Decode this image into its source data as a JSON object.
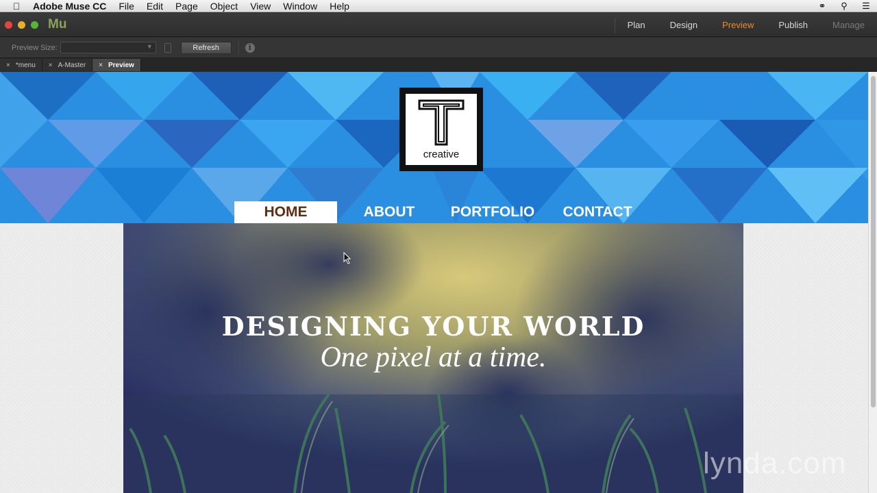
{
  "menubar": {
    "app_name": "Adobe Muse CC",
    "menus": [
      "File",
      "Edit",
      "Page",
      "Object",
      "View",
      "Window",
      "Help"
    ]
  },
  "titlebar": {
    "logo": "Mu",
    "modes": [
      "Plan",
      "Design",
      "Preview",
      "Publish",
      "Manage"
    ],
    "active_mode": "Preview",
    "accent": "#f08a2e"
  },
  "toolbar": {
    "preview_size_label": "Preview Size:",
    "preview_size_value": "",
    "refresh_label": "Refresh"
  },
  "tabs": [
    {
      "label": "*menu",
      "active": false
    },
    {
      "label": "A-Master",
      "active": false
    },
    {
      "label": "Preview",
      "active": true
    }
  ],
  "site": {
    "logo_text": "creative",
    "nav": [
      "HOME",
      "ABOUT",
      "PORTFOLIO",
      "CONTACT"
    ],
    "hero_headline": "DESIGNING YOUR WORLD",
    "hero_tagline": "One pixel at a time.",
    "colors": {
      "nav_active_text": "#5a2f16",
      "header_blue": "#2a8fe0"
    }
  },
  "watermark": "lynda.com"
}
